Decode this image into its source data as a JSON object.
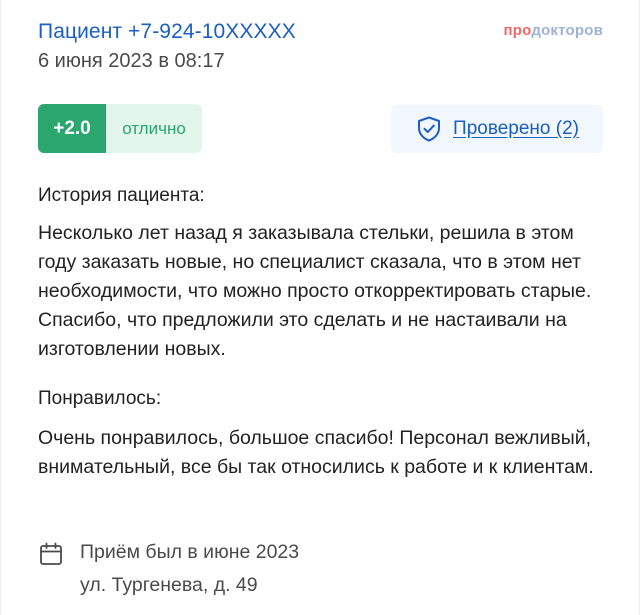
{
  "header": {
    "patient": "Пациент +7-924-10XXXXX",
    "date": "6 июня 2023 в 08:17",
    "logo_pro": "про",
    "logo_doc": "докторов"
  },
  "rating": {
    "score": "+2.0",
    "label": "отлично"
  },
  "verified": {
    "label": "Проверено (2)",
    "icon": "shield-check-icon"
  },
  "history": {
    "title": "История пациента:",
    "text": "Несколько лет назад я заказывала стельки, решила в этом году заказать новые, но специалист сказала, что в этом нет необходимости, что можно просто откорректировать старые. Спасибо, что предложили это сделать и не настаивали на изготовлении новых."
  },
  "liked": {
    "title": "Понравилось:",
    "text": "Очень понравилось, большое спасибо! Персонал вежливый, внимательный, все бы так относились к работе и к клиентам."
  },
  "visit": {
    "icon": "calendar-icon",
    "date": "Приём был в июне 2023",
    "address": "ул. Тургенева, д. 49"
  },
  "colors": {
    "link": "#1a5fc1",
    "rating_green": "#2aa66e",
    "rating_bg": "#e3f6ec",
    "logo_pro": "#f06868",
    "logo_doc": "#9db3d6"
  }
}
